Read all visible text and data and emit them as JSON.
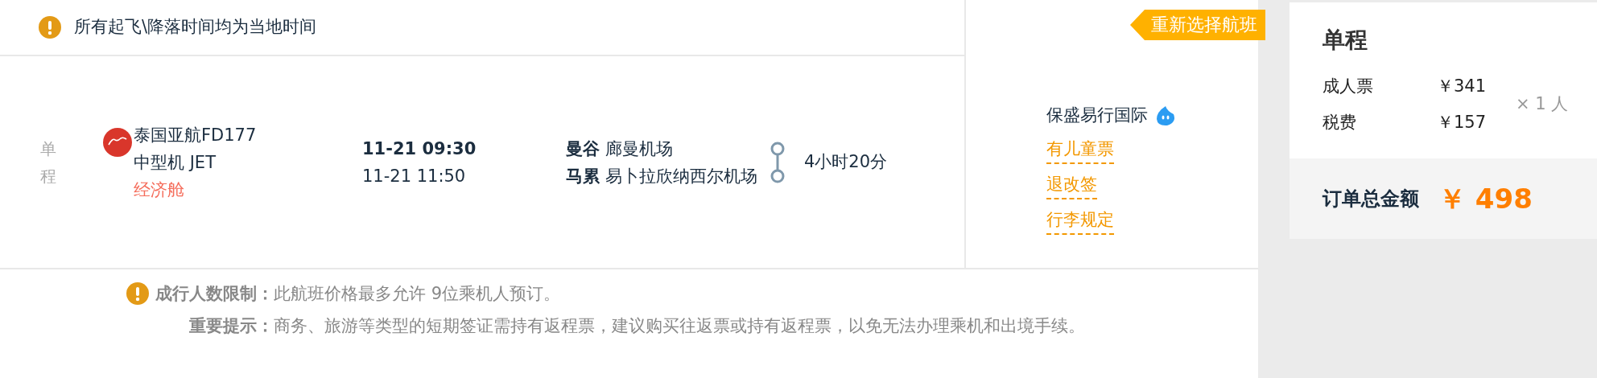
{
  "notice": {
    "text": "所有起飞\\降落时间均为当地时间",
    "kind": "warning"
  },
  "ribbon": {
    "label": "重新选择航班"
  },
  "flight": {
    "trip_type": "单程",
    "airline": "泰国亚航FD177",
    "aircraft": "中型机 JET",
    "cabin": "经济舱",
    "depart_time": "11-21 09:30",
    "arrive_time": "11-21 11:50",
    "origin": {
      "city": "曼谷",
      "airport": "廊曼机场"
    },
    "destination": {
      "city": "马累",
      "airport": "易卜拉欣纳西尔机场"
    },
    "duration": "4小时20分"
  },
  "supplier": {
    "name": "保盛易行国际",
    "links": [
      "有儿童票",
      "退改签",
      "行李规定"
    ]
  },
  "notes": [
    {
      "kind": "warning",
      "label": "成行人数限制：",
      "text": "此航班价格最多允许 9位乘机人预订。"
    },
    {
      "kind": "plain",
      "label": "重要提示：",
      "text": "商务、旅游等类型的短期签证需持有返程票，建议购买往返票或持有返程票，以免无法办理乘机和出境手续。"
    }
  ],
  "summary": {
    "title": "单程",
    "items": [
      {
        "label": "成人票",
        "price": "￥341"
      },
      {
        "label": "税费",
        "price": "￥157"
      }
    ],
    "multiplier": "× 1 人",
    "total_label": "订单总金额",
    "total": "￥ 498"
  }
}
